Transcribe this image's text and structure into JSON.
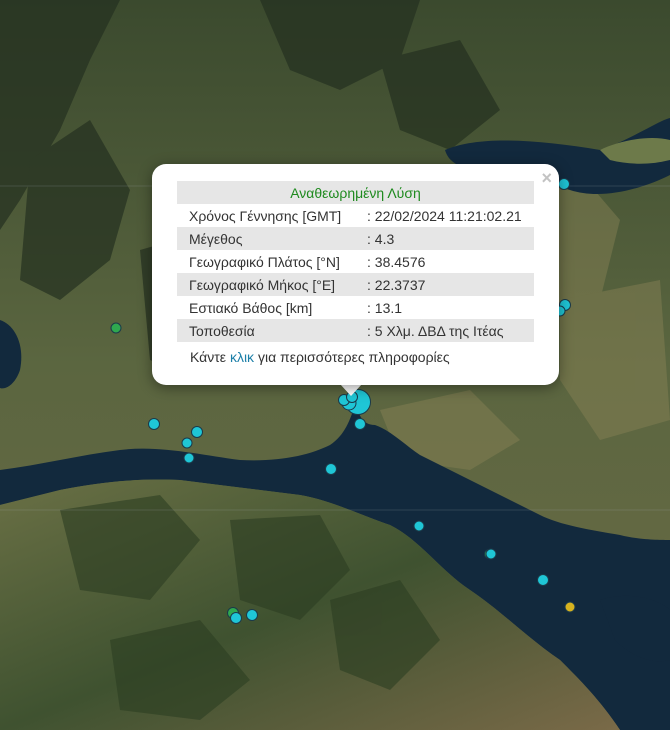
{
  "popup": {
    "title": "Αναθεωρημένη Λύση",
    "close_label": "×",
    "rows": [
      {
        "label": "Χρόνος Γέννησης [GMT]",
        "value": ": 22/02/2024 11:21:02.21"
      },
      {
        "label": "Μέγεθος",
        "value": ": 4.3"
      },
      {
        "label": "Γεωγραφικό Πλάτος [°N]",
        "value": ": 38.4576"
      },
      {
        "label": "Γεωγραφικό Μήκος [°E]",
        "value": ": 22.3737"
      },
      {
        "label": "Εστιακό Βάθος [km]",
        "value": ": 13.1"
      },
      {
        "label": "Τοποθεσία",
        "value": ": 5 Χλμ. ΔΒΔ της Ιτέας"
      }
    ],
    "more_prefix": "Κάντε",
    "more_link": "κλικ",
    "more_suffix": "για περισσότερες πληροφορίες"
  },
  "colors": {
    "marker_cyan": "#1fc6d6",
    "marker_green": "#2fa84f",
    "marker_yellow": "#d7b21f",
    "water": "#12293d",
    "land_dark": "#3a4a2b",
    "land_light": "#6f7a4c",
    "link": "#1c7fa8",
    "title_green": "#1e8a1e"
  },
  "markers": {
    "types": [
      "cyan-event",
      "green-event",
      "yellow-event"
    ]
  }
}
